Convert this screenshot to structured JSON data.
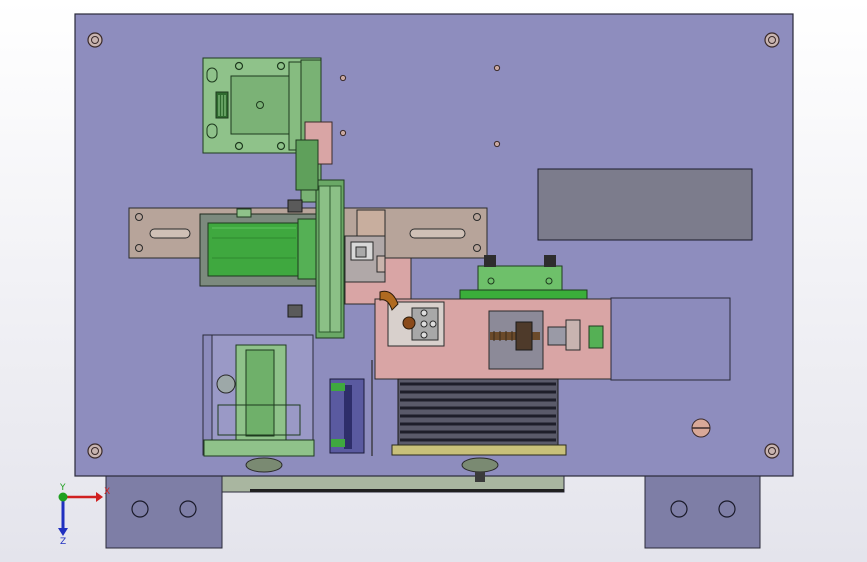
{
  "viewport": {
    "background_top": "#FFFFFF",
    "background_bottom": "#E4E4EC"
  },
  "colors": {
    "plate": "#8E8DBE",
    "plate_stroke": "#2A2A3A",
    "dark_panel": "#7C7C8C",
    "green_part": "#8FC28A",
    "green_dark": "#4E9A4A",
    "green_bright": "#3FA83F",
    "tan_part": "#B7A49A",
    "pink_part": "#D9A5A5",
    "gray_part": "#8A8A96",
    "brown_part": "#8A5A2A",
    "foot": "#7E7EA6",
    "bellows": "#4A4A5E",
    "navy_part": "#4A4A8A",
    "axis_x": "#D02020",
    "axis_y": "#20A020",
    "axis_z": "#2030C0"
  },
  "triad": {
    "x_label": "X",
    "y_label": "Y",
    "z_label": "Z"
  }
}
